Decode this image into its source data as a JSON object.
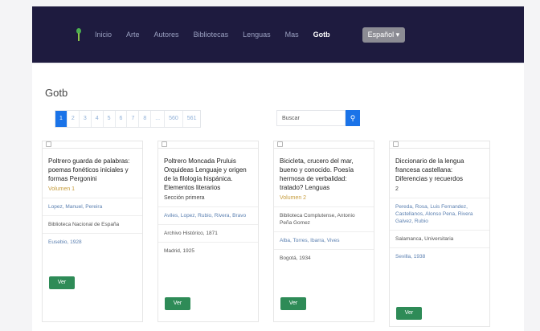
{
  "nav": {
    "links": [
      "Inicio",
      "Arte",
      "Autores",
      "Bibliotecas",
      "Lenguas",
      "Mas",
      "Gotb"
    ],
    "active_index": 6,
    "language_button": "Español ▾"
  },
  "page": {
    "title": "Gotb"
  },
  "pagination": {
    "items": [
      "1",
      "2",
      "3",
      "4",
      "5",
      "6",
      "7",
      "8",
      "...",
      "560",
      "561"
    ],
    "active_index": 0
  },
  "search": {
    "value": "Buscar",
    "icon": "search-icon"
  },
  "cards": [
    {
      "title": "Poltrero guarda de palabras: poemas fonéticos iniciales y formas Pergonini",
      "subtitle": "Volumen 1",
      "items": [
        {
          "text": "Lopez, Manuel, Pereira",
          "link": true
        },
        {
          "text": "Biblioteca Nacional de España",
          "link": false
        },
        {
          "text": "Eusebio, 1928",
          "link": true
        }
      ],
      "button": "Ver"
    },
    {
      "title": "Poltrero Moncada Pruluis Orquideas Lenguaje y origen de la filología hispánica. Elementos literarios",
      "subtitle": "Sección primera",
      "items": [
        {
          "text": "Aviles, Lopez, Rubio, Rivera, Bravo",
          "link": true
        },
        {
          "text": "Archivo Histórico, 1871",
          "link": false
        },
        {
          "text": "Madrid, 1925",
          "link": false
        }
      ],
      "button": "Ver"
    },
    {
      "title": "Bicicleta, crucero del mar, bueno y conocido. Poesía hermosa de verbalidad: tratado? Lenguas",
      "subtitle": "Volumen 2",
      "items": [
        {
          "text": "Biblioteca Complutense, Antonio Peña Gomez",
          "link": false
        },
        {
          "text": "Alba, Torres, Ibarra, Vives",
          "link": true
        },
        {
          "text": "Bogotá, 1934",
          "link": false
        }
      ],
      "button": "Ver"
    },
    {
      "title": "Diccionario de la lengua francesa castellana: Diferencias y recuerdos",
      "subtitle": "2",
      "items": [
        {
          "text": "Pereda, Rosa, Luis Fernandez, Castellanos, Alonso Pena, Rivera Galvez, Rubio",
          "link": true
        },
        {
          "text": "Salamanca, Universitaria",
          "link": false
        },
        {
          "text": "Sevilla, 1938",
          "link": true
        }
      ],
      "button": "Ver"
    }
  ]
}
